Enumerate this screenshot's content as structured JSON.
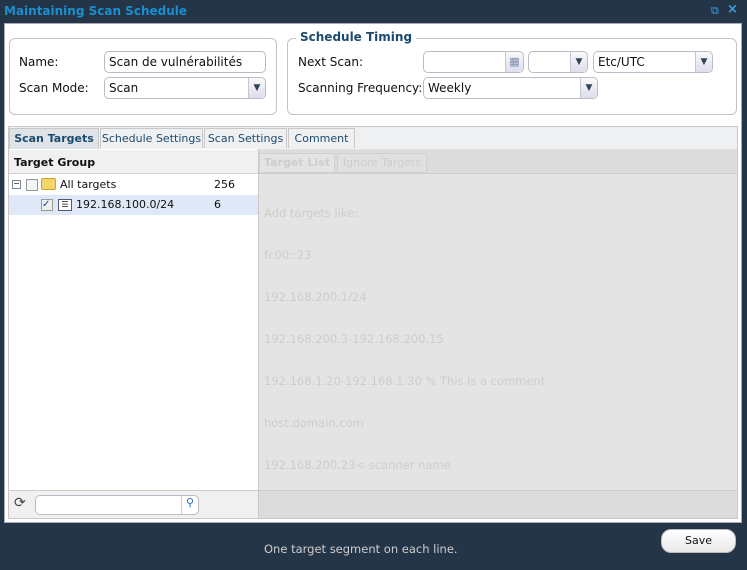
{
  "window": {
    "title": "Maintaining Scan Schedule"
  },
  "form": {
    "name_label": "Name:",
    "name_value": "Scan de vulnérabilités",
    "mode_label": "Scan Mode:",
    "mode_value": "Scan"
  },
  "timing": {
    "legend": "Schedule Timing",
    "next_scan_label": "Next Scan:",
    "next_scan_date": "",
    "next_scan_time": "",
    "timezone": "Etc/UTC",
    "frequency_label": "Scanning Frequency:",
    "frequency_value": "Weekly"
  },
  "tabs": [
    "Scan Targets",
    "Schedule Settings",
    "Scan Settings",
    "Comment"
  ],
  "target_group": {
    "header": "Target Group",
    "rows": [
      {
        "label": "All targets",
        "count": "256",
        "checked": false
      },
      {
        "label": "192.168.100.0/24",
        "count": "6",
        "checked": true
      }
    ],
    "search_placeholder": ""
  },
  "subtabs": [
    "Target List",
    "Ignore Targets"
  ],
  "target_hint": [
    "Add targets like:",
    "fc00::23",
    "192.168.200.1/24",
    "192.168.200.3-192.168.200.15",
    "192.168.1.20-192.168.1.30 % This is a comment",
    "host.domain.com",
    "192.168.200.23< scanner name",
    "",
    "One target segment on each line."
  ],
  "footer": {
    "save_label": "Save"
  }
}
